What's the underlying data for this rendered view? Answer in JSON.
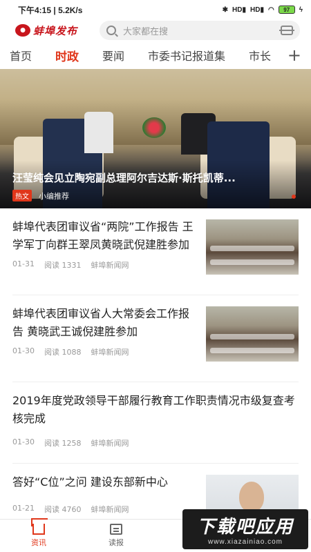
{
  "status_bar": {
    "time": "下午4:15",
    "speed": "5.2K/s",
    "signal_labels": [
      "HD",
      "HD"
    ],
    "battery": "97"
  },
  "header": {
    "logo_text": "蚌埠发布",
    "search_placeholder": "大家都在搜"
  },
  "tabs": [
    {
      "label": "首页"
    },
    {
      "label": "时政",
      "active": true
    },
    {
      "label": "要闻"
    },
    {
      "label": "市委书记报道集"
    },
    {
      "label": "市长"
    }
  ],
  "banner": {
    "title": "汪莹纯会见立陶宛副总理阿尔吉达斯·斯托凯蒂...",
    "tag": "热文",
    "source": "小编推荐"
  },
  "news": [
    {
      "title": "蚌埠代表团审议省“两院”工作报告 王学军丁向群王翠凤黄晓武倪建胜参加",
      "date": "01-31",
      "reads": "阅读 1331",
      "source": "蚌埠新闻网",
      "thumb": "meeting"
    },
    {
      "title": "蚌埠代表团审议省人大常委会工作报告 黄晓武王诚倪建胜参加",
      "date": "01-30",
      "reads": "阅读 1088",
      "source": "蚌埠新闻网",
      "thumb": "meeting"
    },
    {
      "title": "2019年度党政领导干部履行教育工作职责情况市级复查考核完成",
      "date": "01-30",
      "reads": "阅读 1258",
      "source": "蚌埠新闻网",
      "thumb": null
    },
    {
      "title": "答好“C位”之问 建设东部新中心",
      "date": "01-21",
      "reads": "阅读 4760",
      "source": "蚌埠新闻网",
      "thumb": "portrait"
    }
  ],
  "tabbar": [
    {
      "label": "资讯",
      "icon": "home-icon",
      "active": true
    },
    {
      "label": "读报",
      "icon": "newspaper-icon"
    }
  ],
  "watermark": {
    "main": "下载吧应用",
    "url": "www.xiazainiao.com"
  },
  "colors": {
    "accent": "#e0361a",
    "brand": "#c8161d"
  }
}
